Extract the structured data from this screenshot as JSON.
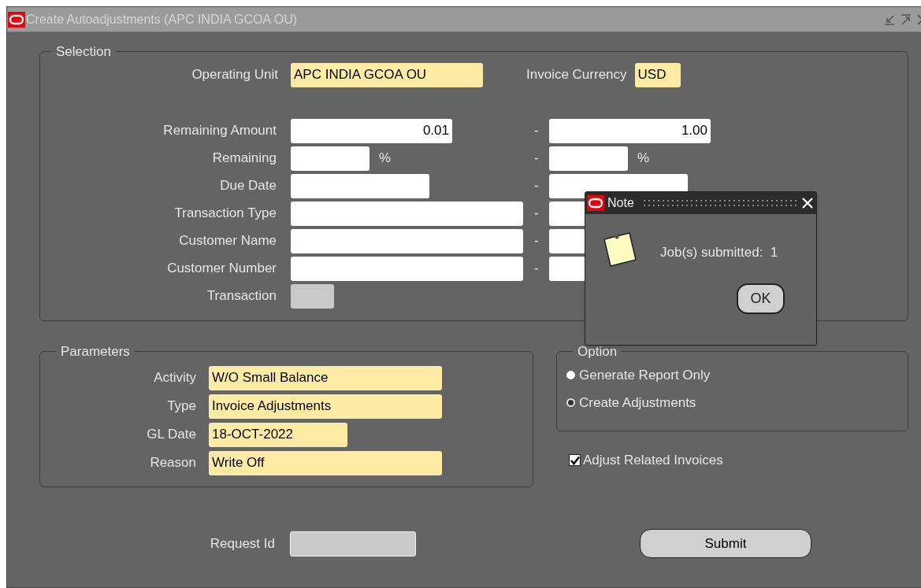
{
  "window": {
    "title": "Create Autoadjustments (APC INDIA GCOA OU)"
  },
  "selection": {
    "title": "Selection",
    "operating_unit": {
      "label": "Operating Unit",
      "value": "APC INDIA GCOA OU"
    },
    "invoice_currency": {
      "label": "Invoice Currency",
      "value": "USD"
    },
    "rows": [
      {
        "label": "Remaining Amount",
        "kind": "amount",
        "from": "0.01",
        "to": "1.00",
        "separator": "-"
      },
      {
        "label": "Remaining",
        "kind": "percent",
        "unit": "%",
        "separator": "-"
      },
      {
        "label": "Due Date",
        "kind": "date",
        "separator": "-"
      },
      {
        "label": "Transaction Type",
        "kind": "text",
        "separator": "-"
      },
      {
        "label": "Customer Name",
        "kind": "text",
        "separator": "-"
      },
      {
        "label": "Customer Number",
        "kind": "text",
        "separator": "-"
      },
      {
        "label": "Transaction",
        "kind": "readonly"
      }
    ]
  },
  "parameters": {
    "title": "Parameters",
    "fields": [
      {
        "label": "Activity",
        "value": "W/O Small Balance",
        "kind": "text"
      },
      {
        "label": "Type",
        "value": "Invoice Adjustments",
        "kind": "text"
      },
      {
        "label": "GL Date",
        "value": "18-OCT-2022",
        "kind": "date"
      },
      {
        "label": "Reason",
        "value": "Write Off",
        "kind": "text"
      }
    ]
  },
  "option": {
    "title": "Option",
    "radios": [
      {
        "label": "Generate Report Only",
        "selected": false
      },
      {
        "label": "Create Adjustments",
        "selected": true
      }
    ]
  },
  "adjust_related": {
    "label": "Adjust Related Invoices",
    "checked": true
  },
  "request_id": {
    "label": "Request Id"
  },
  "submit_button": "Submit",
  "note": {
    "title": "Note",
    "message": "Job(s) submitted:  1",
    "ok_button": "OK"
  }
}
